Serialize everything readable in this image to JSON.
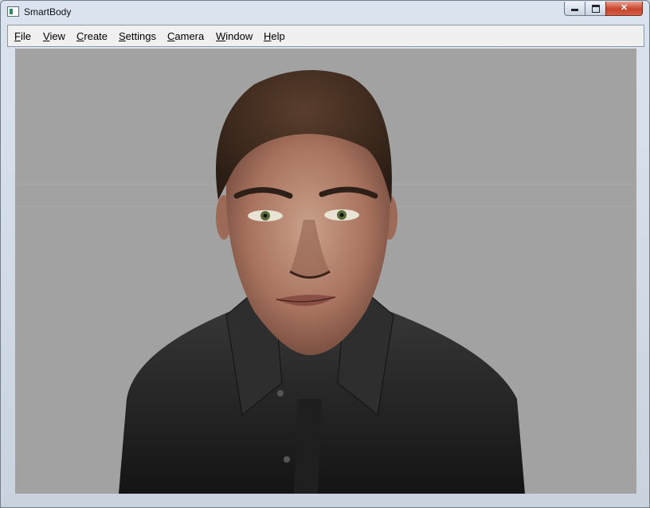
{
  "window": {
    "title": "SmartBody"
  },
  "controls": {
    "minimize_icon": "minimize-icon",
    "maximize_icon": "maximize-icon",
    "close_label": "✕"
  },
  "menu": {
    "items": [
      "File",
      "View",
      "Create",
      "Settings",
      "Camera",
      "Window",
      "Help"
    ]
  },
  "colors": {
    "viewport_background": "#a2a2a2",
    "close_button": "#c7432a"
  }
}
